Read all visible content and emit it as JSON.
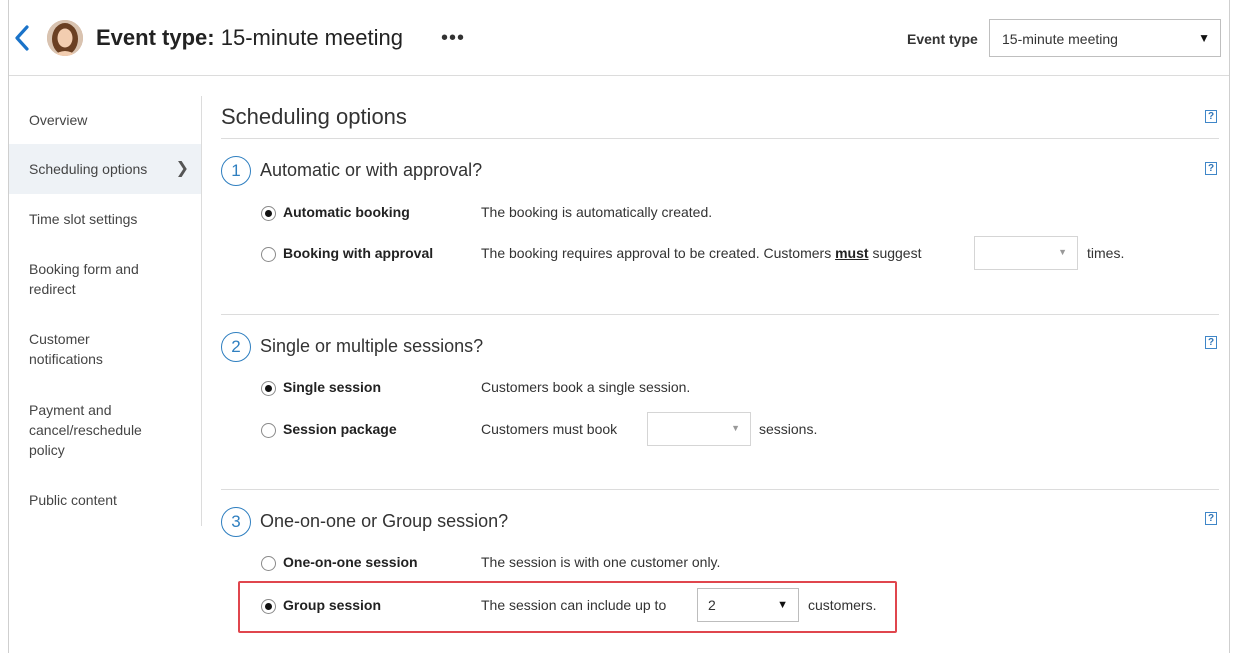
{
  "header": {
    "title_prefix": "Event type:",
    "title_value": "15-minute meeting",
    "more": "•••",
    "event_type_label": "Event type",
    "event_type_value": "15-minute meeting"
  },
  "sidebar": {
    "items": [
      {
        "label": "Overview"
      },
      {
        "label": "Scheduling options"
      },
      {
        "label": "Time slot settings"
      },
      {
        "label": "Booking form and redirect"
      },
      {
        "label": "Customer notifications"
      },
      {
        "label": "Payment and cancel/reschedule policy"
      },
      {
        "label": "Public content"
      }
    ]
  },
  "main": {
    "title": "Scheduling options",
    "help": "?",
    "sections": [
      {
        "number": "1",
        "title": "Automatic or with approval?",
        "options": [
          {
            "label": "Automatic booking",
            "desc": "The booking is automatically created.",
            "checked": true
          },
          {
            "label": "Booking with approval",
            "desc_pre": "The booking requires approval to be created. Customers",
            "desc_emph": "must",
            "desc_post": "suggest",
            "select_value": "",
            "desc_tail": "times.",
            "checked": false
          }
        ]
      },
      {
        "number": "2",
        "title": "Single or multiple sessions?",
        "options": [
          {
            "label": "Single session",
            "desc": "Customers book a single session.",
            "checked": true
          },
          {
            "label": "Session package",
            "desc_pre": "Customers must book",
            "select_value": "",
            "desc_tail": "sessions.",
            "checked": false
          }
        ]
      },
      {
        "number": "3",
        "title": "One-on-one or Group session?",
        "options": [
          {
            "label": "One-on-one session",
            "desc": "The session is with one customer only.",
            "checked": false
          },
          {
            "label": "Group session",
            "desc_pre": "The session can include up to",
            "select_value": "2",
            "desc_tail": "customers.",
            "checked": true
          }
        ]
      }
    ]
  },
  "colors": {
    "accent": "#2f7fc0",
    "highlight": "#e0464d",
    "active_bg": "#eef2f6"
  }
}
